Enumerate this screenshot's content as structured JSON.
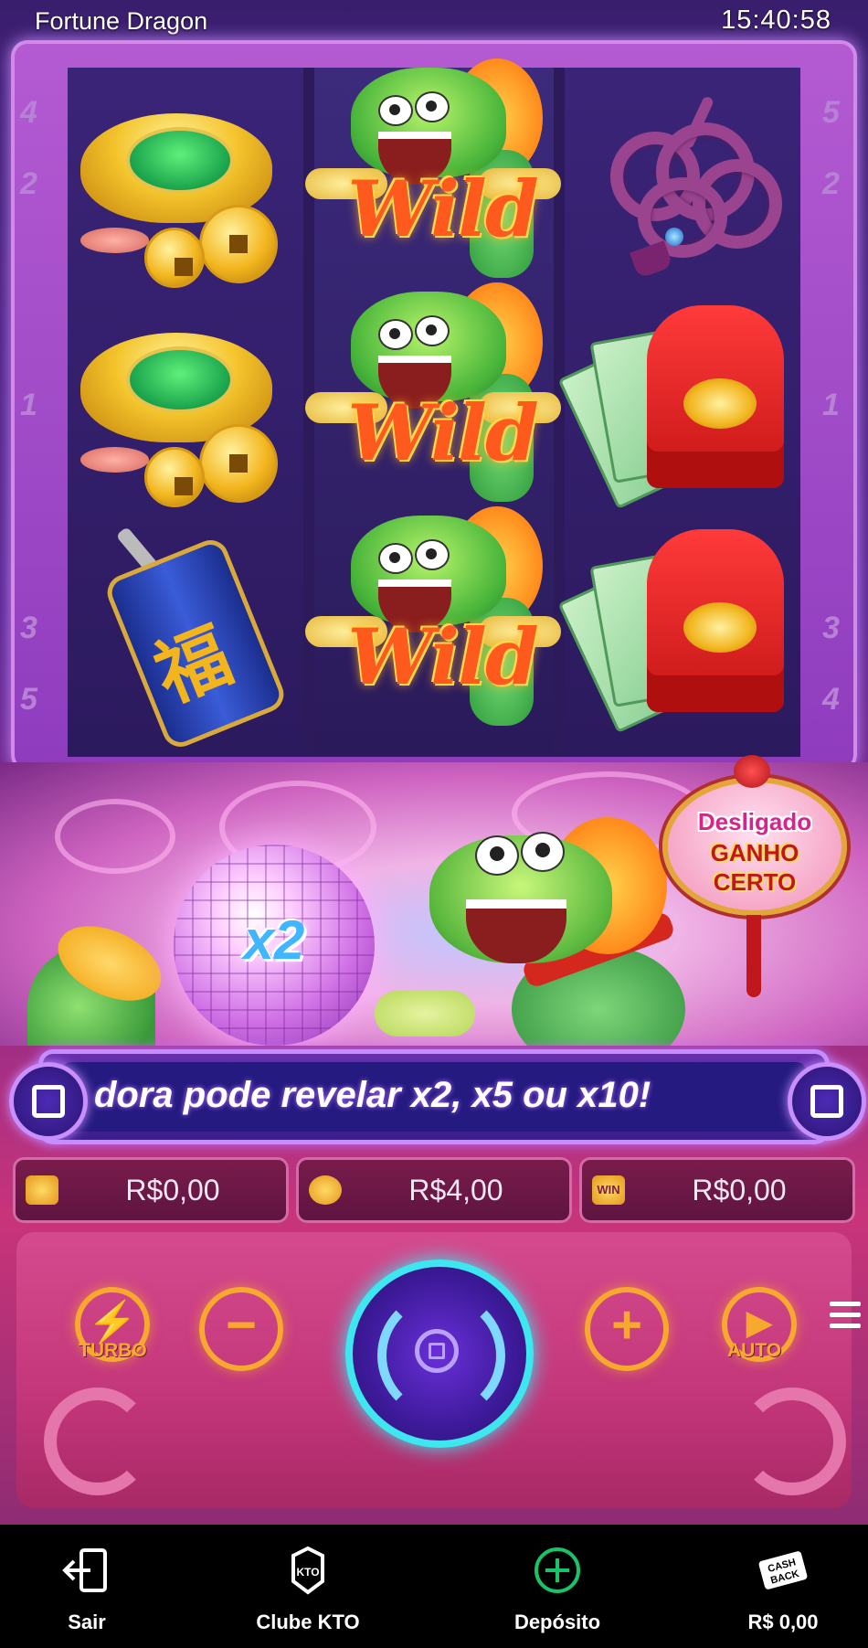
{
  "header": {
    "title": "Fortune Dragon",
    "time": "15:40:58"
  },
  "paylines": {
    "left": [
      "4",
      "2",
      "1",
      "3",
      "5"
    ],
    "right": [
      "5",
      "2",
      "1",
      "3",
      "4"
    ]
  },
  "reels": {
    "reel1": [
      "gold-ingot",
      "gold-ingot",
      "firecracker"
    ],
    "reel2": [
      "wild",
      "wild",
      "wild"
    ],
    "reel3": [
      "knot",
      "red-envelope",
      "red-envelope"
    ],
    "wild_label": "Wild",
    "firecracker_char": "福"
  },
  "feature": {
    "multiplier_label": "x2",
    "lantern_status": "Desligado",
    "lantern_line2": "GANHO",
    "lantern_line3": "CERTO"
  },
  "marquee": {
    "text": "dora pode revelar x2, x5 ou x10!"
  },
  "balances": {
    "balance": "R$0,00",
    "bet": "R$4,00",
    "win": "R$0,00",
    "win_icon_label": "WIN"
  },
  "controls": {
    "turbo_label": "TURBO",
    "auto_label": "AUTO",
    "minus": "−",
    "plus": "+"
  },
  "bottom_nav": {
    "sair": "Sair",
    "clube": "Clube KTO",
    "deposito": "Depósito",
    "cashback_value": "R$ 0,00",
    "kto_icon_text": "KTO",
    "cashback_icon_line1": "CASH",
    "cashback_icon_line2": "BACK"
  },
  "colors": {
    "accent_orange": "#f7a82e",
    "spin_ring": "#3ee6f0",
    "deposit_green": "#18c46a"
  }
}
